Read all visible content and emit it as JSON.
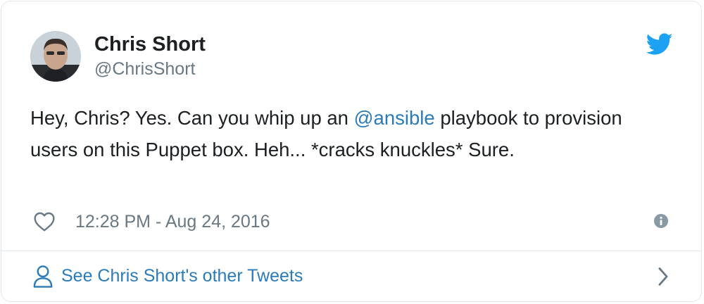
{
  "author": {
    "display_name": "Chris Short",
    "screen_name": "@ChrisShort"
  },
  "tweet": {
    "text_before": "Hey, Chris? Yes. Can you whip up an ",
    "mention": "@ansible",
    "text_after": " playbook to provision users on this Puppet box. Heh... *cracks knuckles* Sure."
  },
  "meta": {
    "timestamp": "12:28 PM - Aug 24, 2016"
  },
  "footer": {
    "label": "See Chris Short's other Tweets"
  },
  "icons": {
    "brand": "twitter-bird-icon",
    "like": "heart-icon",
    "info": "info-icon",
    "profile": "person-icon",
    "next": "chevron-right-icon"
  },
  "colors": {
    "brand_blue": "#1da1f2",
    "link_blue": "#2b7bb9",
    "text": "#1c2022",
    "secondary_text": "#697882",
    "border": "#e1e8ed"
  }
}
